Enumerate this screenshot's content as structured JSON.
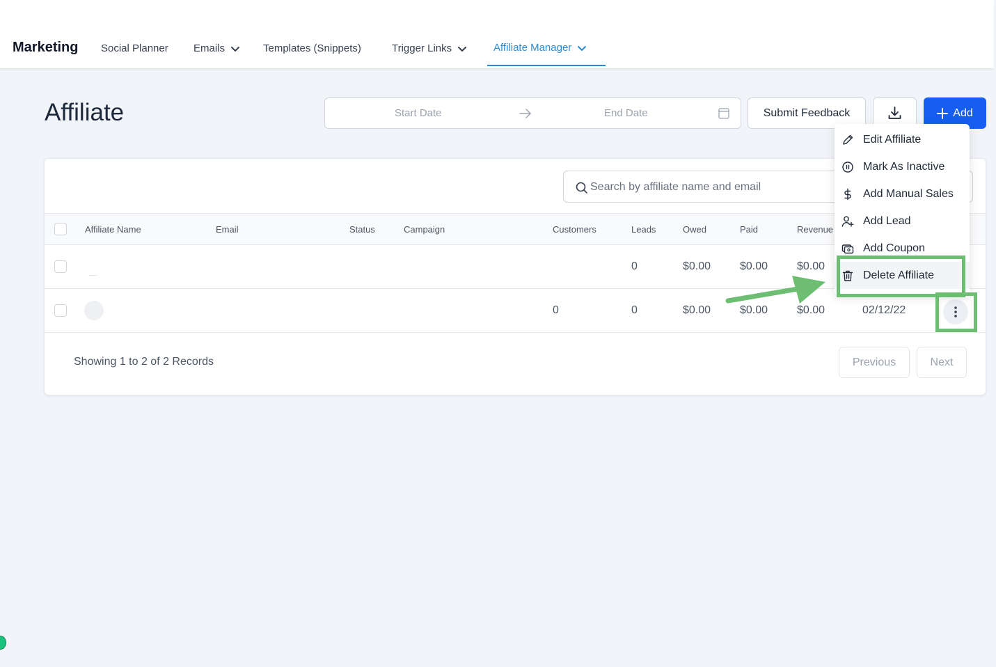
{
  "nav": {
    "brand": "Marketing",
    "items": [
      {
        "label": "Social Planner"
      },
      {
        "label": "Emails"
      },
      {
        "label": "Templates (Snippets)"
      },
      {
        "label": "Trigger Links"
      },
      {
        "label": "Affiliate Manager"
      }
    ]
  },
  "page": {
    "title": "Affiliate"
  },
  "date_range": {
    "start_placeholder": "Start Date",
    "end_placeholder": "End Date"
  },
  "toolbar": {
    "feedback_label": "Submit Feedback",
    "add_label": "Add"
  },
  "search": {
    "placeholder": "Search by affiliate name and email"
  },
  "table": {
    "columns": [
      "Affiliate Name",
      "Email",
      "Status",
      "Campaign",
      "Customers",
      "Leads",
      "Owed",
      "Paid",
      "Revenue"
    ],
    "rows": [
      {
        "customers": "",
        "leads": "0",
        "owed": "$0.00",
        "paid": "$0.00",
        "revenue": "$0.00",
        "date": ""
      },
      {
        "customers": "0",
        "leads": "0",
        "owed": "$0.00",
        "paid": "$0.00",
        "revenue": "$0.00",
        "date": "02/12/22"
      }
    ]
  },
  "footer": {
    "summary": "Showing 1 to 2 of 2 Records",
    "previous": "Previous",
    "next": "Next"
  },
  "menu": {
    "items": [
      {
        "label": "Edit Affiliate",
        "icon": "pencil-icon"
      },
      {
        "label": "Mark As Inactive",
        "icon": "pause-circle-icon"
      },
      {
        "label": "Add Manual Sales",
        "icon": "dollar-icon"
      },
      {
        "label": "Add Lead",
        "icon": "user-plus-icon"
      },
      {
        "label": "Add Coupon",
        "icon": "coupon-icon"
      },
      {
        "label": "Delete Affiliate",
        "icon": "trash-icon"
      }
    ]
  },
  "colors": {
    "accent": "#2a8bd5",
    "primary_button": "#155eef",
    "highlight": "#6dbe72"
  }
}
